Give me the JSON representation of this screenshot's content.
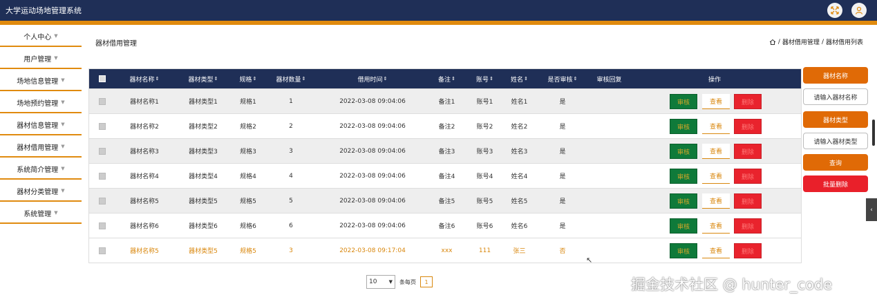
{
  "app": {
    "title": "大学运动场地管理系统"
  },
  "sidebar": {
    "items": [
      {
        "label": "个人中心"
      },
      {
        "label": "用户管理"
      },
      {
        "label": "场地信息管理"
      },
      {
        "label": "场地预约管理"
      },
      {
        "label": "器材信息管理"
      },
      {
        "label": "器材借用管理"
      },
      {
        "label": "系统简介管理"
      },
      {
        "label": "器材分类管理"
      },
      {
        "label": "系统管理"
      }
    ]
  },
  "page": {
    "title": "器材借用管理"
  },
  "breadcrumb": {
    "level1": "器材借用管理",
    "sep1": "/",
    "level2": "器材借用列表",
    "sep0": "/"
  },
  "table": {
    "headers": {
      "name": "器材名称",
      "type": "器材类型",
      "spec": "规格",
      "qty": "器材数量",
      "time": "借用时间",
      "note": "备注",
      "account": "账号",
      "person": "姓名",
      "approved": "是否审核",
      "reply": "审核回复",
      "ops": "操作"
    },
    "buttons": {
      "audit": "审核",
      "view": "查看",
      "delete": "删除"
    },
    "rows": [
      {
        "name": "器材名称1",
        "type": "器材类型1",
        "spec": "规格1",
        "qty": "1",
        "time": "2022-03-08 09:04:06",
        "note": "备注1",
        "account": "账号1",
        "person": "姓名1",
        "approved": "是",
        "reply": ""
      },
      {
        "name": "器材名称2",
        "type": "器材类型2",
        "spec": "规格2",
        "qty": "2",
        "time": "2022-03-08 09:04:06",
        "note": "备注2",
        "account": "账号2",
        "person": "姓名2",
        "approved": "是",
        "reply": ""
      },
      {
        "name": "器材名称3",
        "type": "器材类型3",
        "spec": "规格3",
        "qty": "3",
        "time": "2022-03-08 09:04:06",
        "note": "备注3",
        "account": "账号3",
        "person": "姓名3",
        "approved": "是",
        "reply": ""
      },
      {
        "name": "器材名称4",
        "type": "器材类型4",
        "spec": "规格4",
        "qty": "4",
        "time": "2022-03-08 09:04:06",
        "note": "备注4",
        "account": "账号4",
        "person": "姓名4",
        "approved": "是",
        "reply": ""
      },
      {
        "name": "器材名称5",
        "type": "器材类型5",
        "spec": "规格5",
        "qty": "5",
        "time": "2022-03-08 09:04:06",
        "note": "备注5",
        "account": "账号5",
        "person": "姓名5",
        "approved": "是",
        "reply": ""
      },
      {
        "name": "器材名称6",
        "type": "器材类型6",
        "spec": "规格6",
        "qty": "6",
        "time": "2022-03-08 09:04:06",
        "note": "备注6",
        "account": "账号6",
        "person": "姓名6",
        "approved": "是",
        "reply": ""
      },
      {
        "name": "器材名称5",
        "type": "器材类型5",
        "spec": "规格5",
        "qty": "3",
        "time": "2022-03-08 09:17:04",
        "note": "xxx",
        "account": "111",
        "person": "张三",
        "approved": "否",
        "reply": ""
      }
    ]
  },
  "pager": {
    "page_size": "10",
    "per_page_label": "条每页",
    "current_page": "1"
  },
  "search_panel": {
    "name_label": "器材名称",
    "name_placeholder": "请输入器材名称",
    "type_label": "器材类型",
    "type_placeholder": "请输入器材类型",
    "query_button": "查询",
    "batch_delete_button": "批量删除"
  },
  "watermark": "掘金技术社区 @ hunter_code",
  "icons": {
    "fullscreen": "fullscreen-icon",
    "user": "user-icon",
    "home": "home-icon",
    "collapse": "chevron-left-icon"
  },
  "colors": {
    "header": "#1f2f57",
    "accent": "#e08a0e",
    "danger": "#e9232d",
    "success": "#0f7a3a"
  }
}
